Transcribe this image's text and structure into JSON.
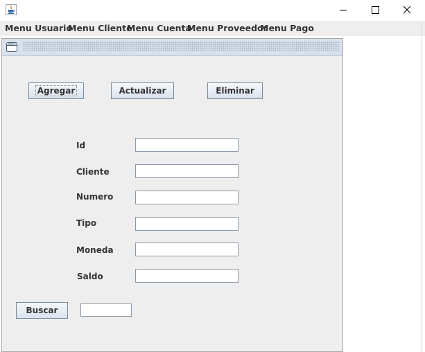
{
  "window": {
    "icon": "java-cup-icon",
    "controls": {
      "minimize": "minimize-icon",
      "maximize": "maximize-icon",
      "close": "close-icon"
    }
  },
  "menubar": {
    "items": [
      {
        "label": "Menu Usuario"
      },
      {
        "label": "Menu Cliente"
      },
      {
        "label": "Menu Cuenta"
      },
      {
        "label": "Menu Proveedor"
      },
      {
        "label": "Menu Pago"
      }
    ]
  },
  "internal_frame": {
    "icon": "frame-window-icon",
    "buttons": {
      "agregar": "Agregar",
      "actualizar": "Actualizar",
      "eliminar": "Eliminar"
    },
    "fields": [
      {
        "label": "Id",
        "value": ""
      },
      {
        "label": "Cliente",
        "value": ""
      },
      {
        "label": "Numero",
        "value": ""
      },
      {
        "label": "Tipo",
        "value": ""
      },
      {
        "label": "Moneda",
        "value": ""
      },
      {
        "label": "Saldo",
        "value": ""
      }
    ],
    "search": {
      "button": "Buscar",
      "value": ""
    }
  },
  "colors": {
    "menubar_bg": "#eeeeee",
    "frame_bg": "#eeeeee",
    "title_bg": "#d8e1ec",
    "text": "#333333"
  }
}
